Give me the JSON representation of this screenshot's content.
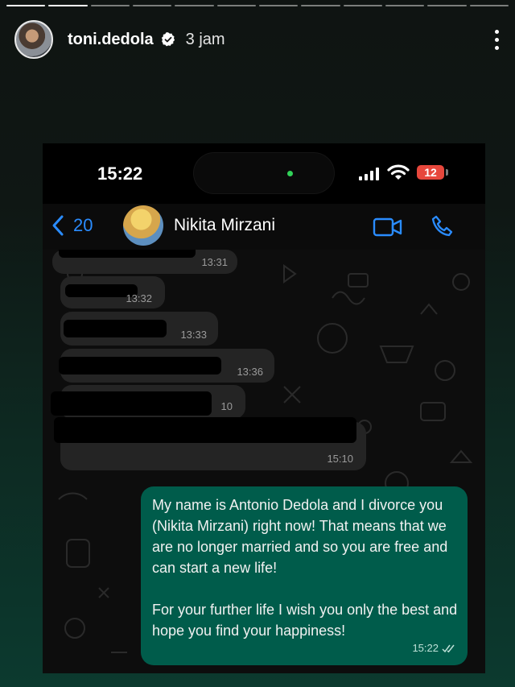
{
  "story": {
    "username": "toni.dedola",
    "time_ago": "3 jam",
    "segments_total": 12,
    "segments_viewed": 2
  },
  "phone": {
    "clock": "15:22",
    "battery": "12"
  },
  "chat": {
    "back_count": "20",
    "contact_name": "Nikita Mirzani",
    "incoming": [
      {
        "time": "13:31"
      },
      {
        "time": "13:32"
      },
      {
        "time": "13:33"
      },
      {
        "time": "13:36"
      },
      {
        "time": "10"
      },
      {
        "time": "15:10"
      }
    ],
    "outgoing": {
      "text": "My name is Antonio Dedola and I divorce you (Nikita Mirzani) right now! That means that we are no longer married and so you are free and can start a new life!\n\nFor your further life I wish you only the best and hope you find your happiness!",
      "time": "15:22"
    }
  },
  "colors": {
    "accent_blue": "#2a8cff",
    "outgoing_bubble": "#005c4b",
    "incoming_bubble": "#242424",
    "battery_low": "#e7473c"
  },
  "icons": [
    "verified-badge-icon",
    "more-options-icon",
    "back-chevron-icon",
    "video-call-icon",
    "phone-call-icon",
    "signal-icon",
    "wifi-icon",
    "battery-icon",
    "read-receipt-icon"
  ]
}
